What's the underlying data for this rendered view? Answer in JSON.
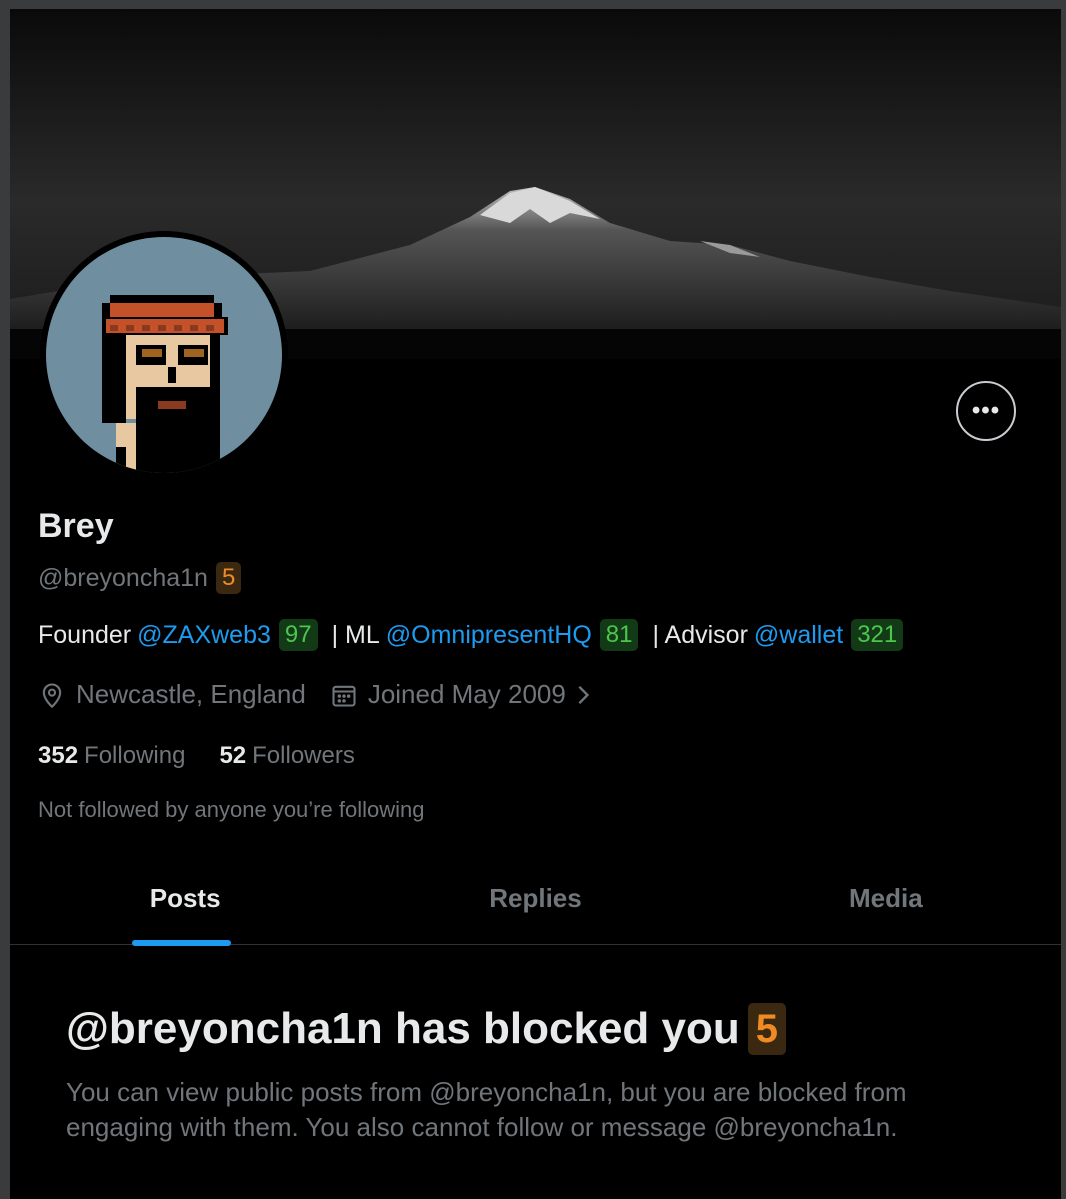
{
  "profile": {
    "name": "Brey",
    "handle": "@breyoncha1n",
    "handle_badge": "5",
    "bio": {
      "founder_label": "Founder",
      "founder_link": "@ZAXweb3",
      "founder_badge": "97",
      "ml_label": "| ML",
      "ml_link": "@OmnipresentHQ",
      "ml_badge": "81",
      "advisor_label": "| Advisor",
      "advisor_link": "@wallet",
      "advisor_badge": "321"
    },
    "location": "Newcastle, England",
    "joined": "Joined May 2009",
    "following_count": "352",
    "following_label": "Following",
    "followers_count": "52",
    "followers_label": "Followers",
    "not_followed": "Not followed by anyone you’re following"
  },
  "actions": {
    "more_label": "•••"
  },
  "tabs": [
    {
      "label": "Posts",
      "active": true
    },
    {
      "label": "Replies",
      "active": false
    },
    {
      "label": "Media",
      "active": false
    }
  ],
  "blocked": {
    "title": "@breyoncha1n has blocked you",
    "badge": "5",
    "description": "You can view public posts from @breyoncha1n, but you are blocked from engaging with them. You also cannot follow or message @breyoncha1n."
  },
  "colors": {
    "background": "#000000",
    "link": "#1d9bf0",
    "muted": "#71767b",
    "badge_orange": "#f08a24",
    "badge_green": "#4cc64c"
  },
  "icons": [
    "location-pin-icon",
    "calendar-icon",
    "chevron-right-icon",
    "more-horizontal-icon"
  ]
}
